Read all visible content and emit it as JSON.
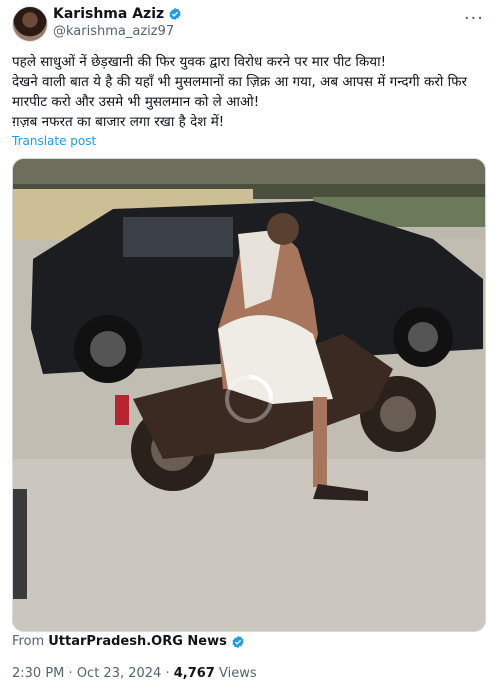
{
  "post": {
    "author_name": "Karishma Aziz",
    "author_handle": "@karishma_aziz97",
    "more_icon": "···",
    "text": "पहले साधुओं नें छेड़खानी की फिर युवक द्वारा विरोध करने पर मार पीट किया!\nदेखने वाली बात ये है की यहाँ भी मुसलमानों का ज़िक्र आ गया, अब आपस में गन्दगी करो फिर मारपीट करो और उसमे भी मुसलमान को ले आओ!\nग़ज़ब नफरत का बाजार लगा रखा है देश में!",
    "translate_label": "Translate post",
    "source_prefix": "From",
    "source_name": "UttarPradesh.ORG News",
    "time": "2:30 PM",
    "separator": "·",
    "date": "Oct 23, 2024",
    "views_count": "4,767",
    "views_label": "Views"
  },
  "colors": {
    "accent": "#1d9bf0",
    "muted": "#536471",
    "text": "#0f1419"
  }
}
